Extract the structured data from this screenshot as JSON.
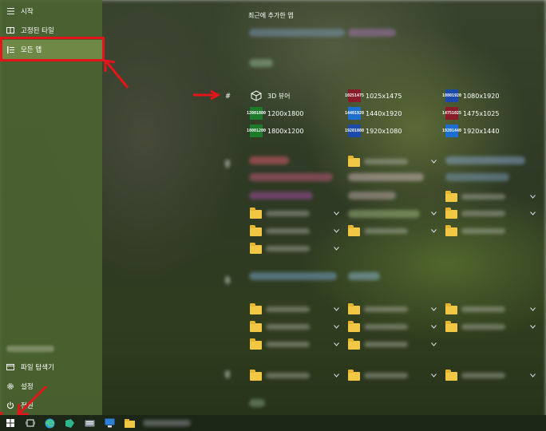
{
  "sidebar": {
    "items": [
      {
        "label": "시작",
        "icon": "hamburger-icon"
      },
      {
        "label": "고정된 타일",
        "icon": "tiles-icon"
      },
      {
        "label": "모든 앱",
        "icon": "list-icon"
      }
    ],
    "bottom": [
      {
        "label": "파일 탐색기",
        "icon": "folder-icon"
      },
      {
        "label": "설정",
        "icon": "gear-icon"
      },
      {
        "label": "전원",
        "icon": "power-icon"
      }
    ]
  },
  "main": {
    "header": "최근에 추가한 앱",
    "section_hash": "#",
    "apps": [
      {
        "label": "3D 뷰어",
        "icon": "cube-icon"
      },
      {
        "label": "1025x1475",
        "top": "1025",
        "bottom": "1475",
        "color": "#8a1b2a"
      },
      {
        "label": "1080x1920",
        "top": "1080",
        "bottom": "1920",
        "color": "#1c4aa8"
      },
      {
        "label": "1200x1800",
        "top": "1200",
        "bottom": "1800",
        "color": "#1d7a2a"
      },
      {
        "label": "1440x1920",
        "top": "1440",
        "bottom": "1920",
        "color": "#1c6fd0"
      },
      {
        "label": "1475x1025",
        "top": "1475",
        "bottom": "1025",
        "color": "#8a1b2a"
      },
      {
        "label": "1800x1200",
        "top": "1800",
        "bottom": "1200",
        "color": "#1d7a2a"
      },
      {
        "label": "1920x1080",
        "top": "1920",
        "bottom": "1080",
        "color": "#1c4aa8"
      },
      {
        "label": "1920x1440",
        "top": "1920",
        "bottom": "1440",
        "color": "#1c6fd0"
      }
    ]
  },
  "colors": {
    "accent_red": "#e4141b",
    "folder": "#f2c744",
    "taskbar": "#1b2616"
  }
}
